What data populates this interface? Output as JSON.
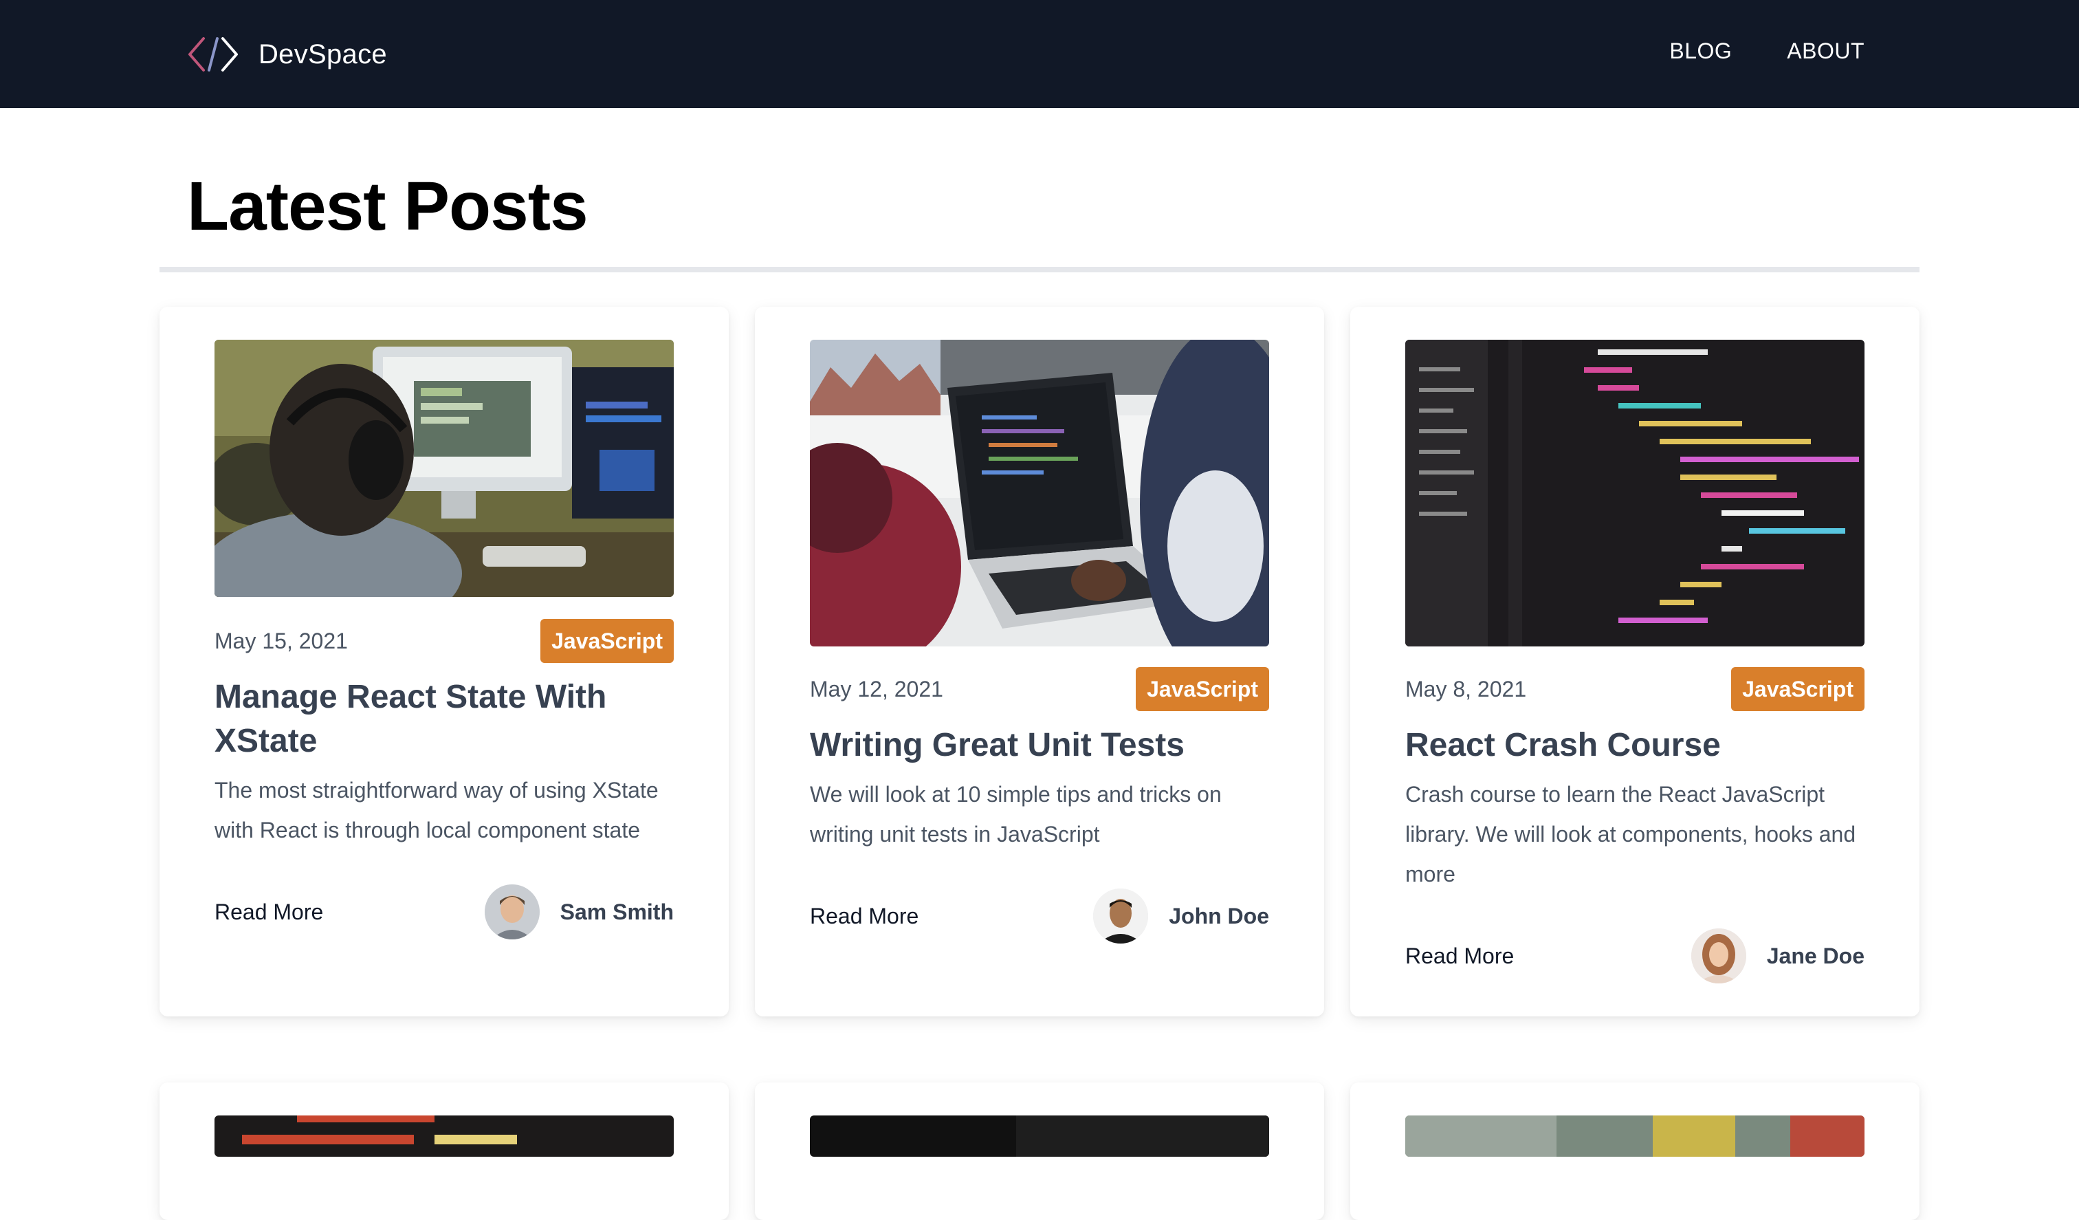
{
  "nav": {
    "brand": "DevSpace",
    "logo_icon": "code-brackets-icon",
    "links": [
      "BLOG",
      "ABOUT"
    ]
  },
  "page": {
    "title": "Latest Posts"
  },
  "posts": [
    {
      "date": "May 15, 2021",
      "category": "JavaScript",
      "title": "Manage React State With XState",
      "excerpt": "The most straightforward way of using XState with React is through local component state",
      "read_more": "Read More",
      "author": "Sam Smith",
      "image_icon": "developer-with-headphones-image"
    },
    {
      "date": "May 12, 2021",
      "category": "JavaScript",
      "title": "Writing Great Unit Tests",
      "excerpt": "We will look at 10 simple tips and tricks on writing unit tests in JavaScript",
      "read_more": "Read More",
      "author": "John Doe",
      "image_icon": "laptop-coding-image"
    },
    {
      "date": "May 8, 2021",
      "category": "JavaScript",
      "title": "React Crash Course",
      "excerpt": "Crash course to learn the React JavaScript library. We will look at components, hooks and more",
      "read_more": "Read More",
      "author": "Jane Doe",
      "image_icon": "code-editor-image"
    }
  ],
  "colors": {
    "navbar": "#111827",
    "tag": "#d97f2b",
    "title_text": "#374151",
    "rule": "#e5e7eb"
  }
}
